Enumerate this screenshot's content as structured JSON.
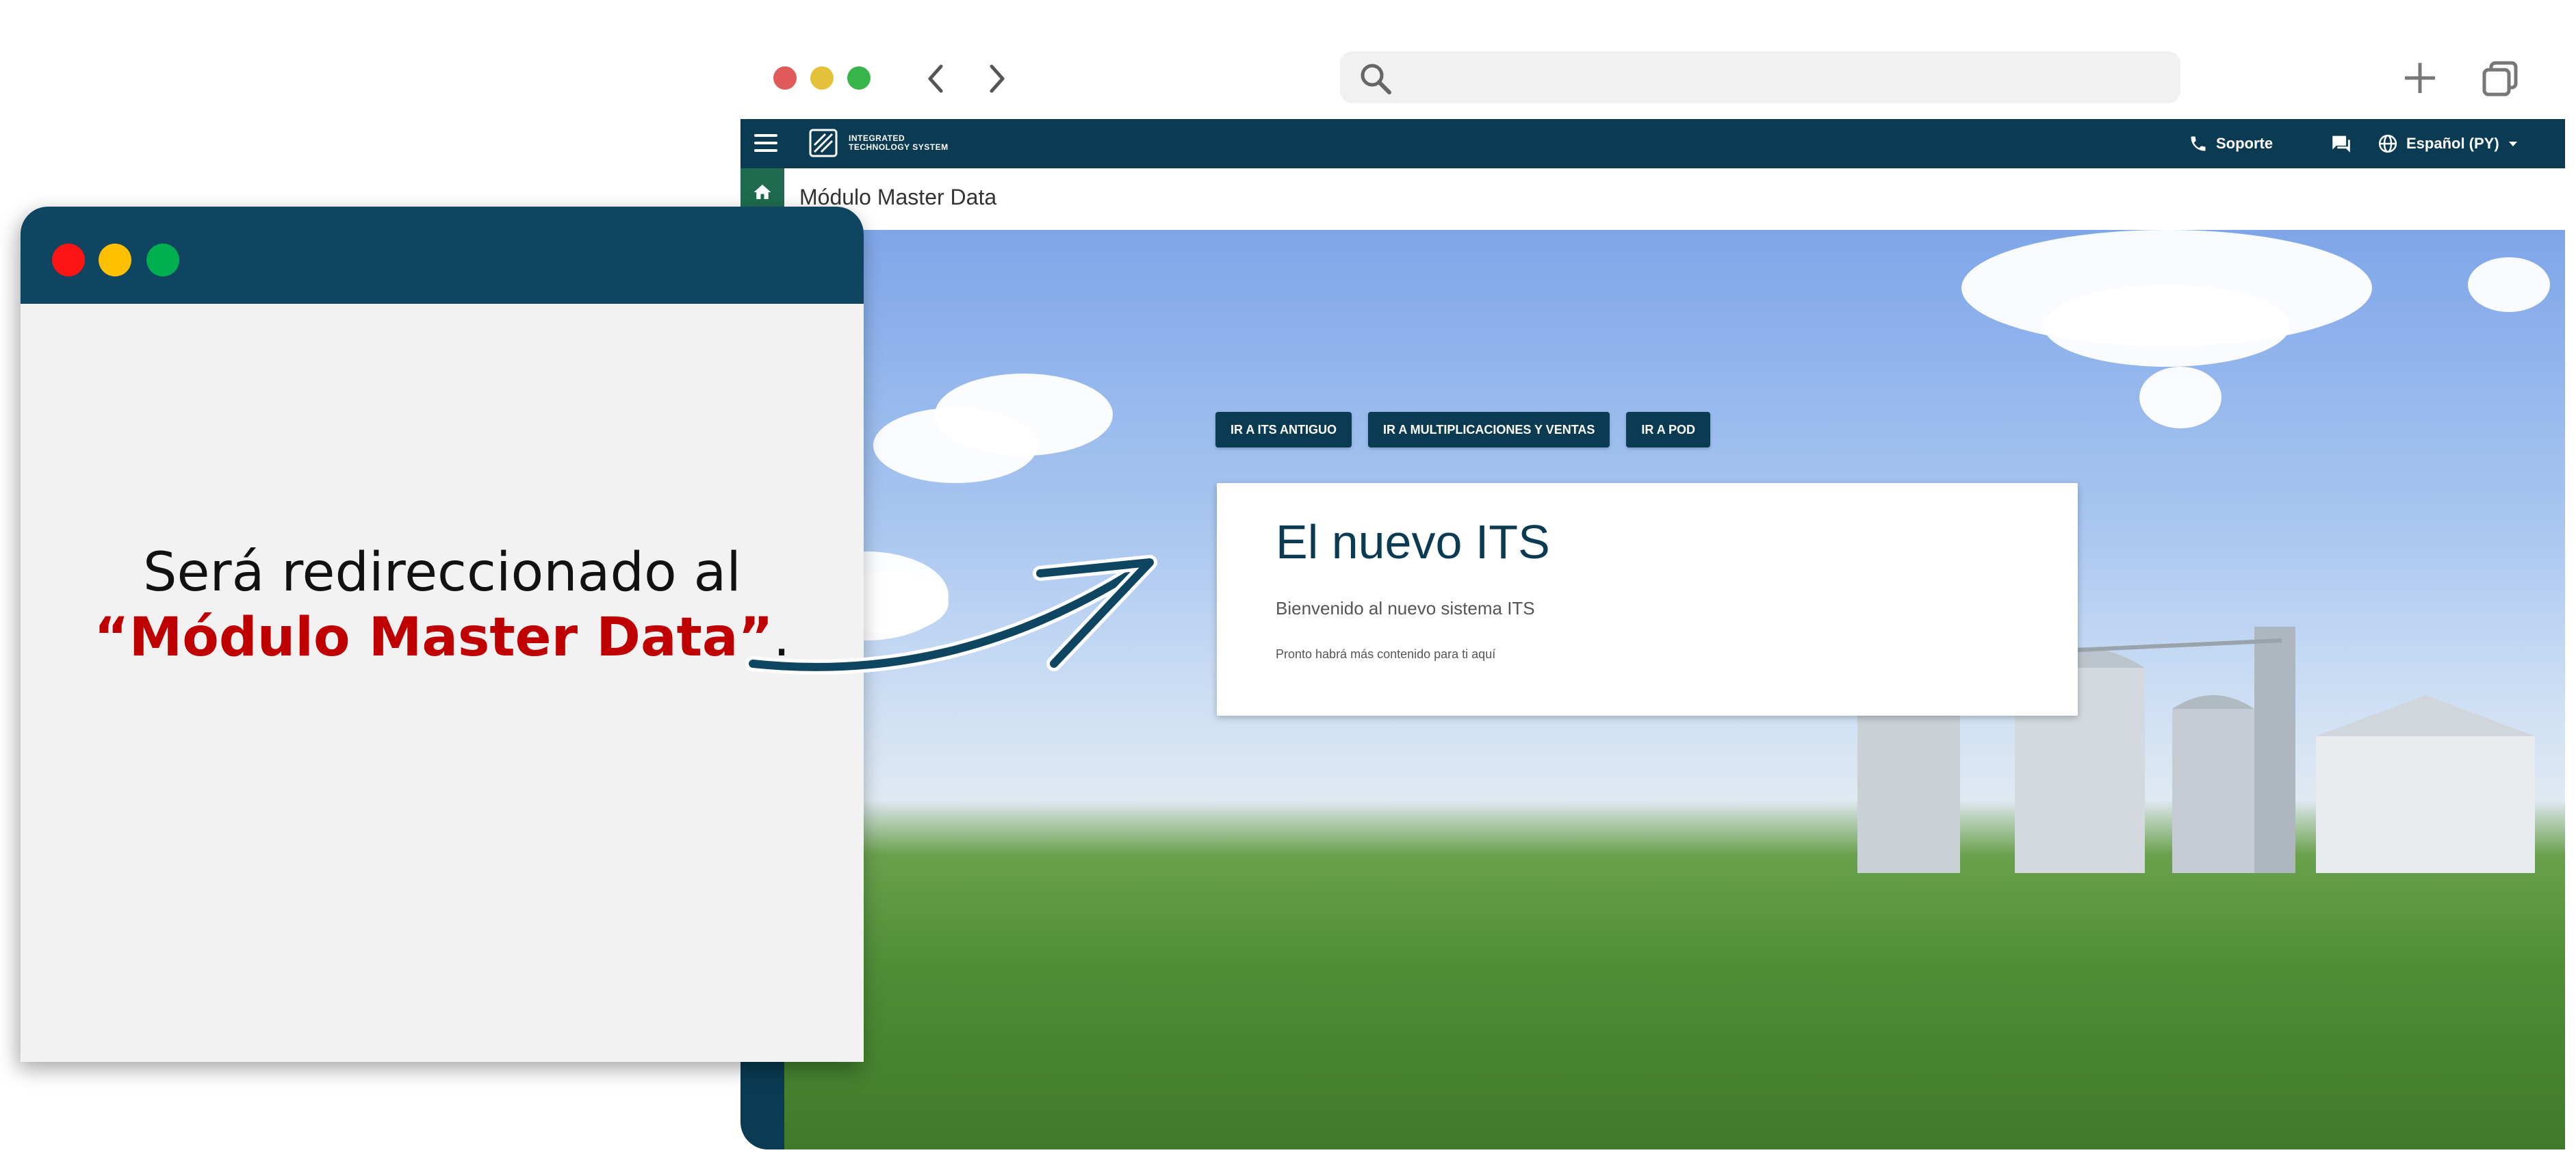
{
  "app_bar": {
    "logo_line1": "INTEGRATED",
    "logo_line2": "TECHNOLOGY SYSTEM",
    "support_label": "Soporte",
    "language_label": "Español (PY)"
  },
  "breadcrumb": {
    "title": "Módulo Master Data"
  },
  "hero": {
    "buttons": [
      "IR A ITS ANTIGUO",
      "IR A MULTIPLICACIONES Y VENTAS",
      "IR A POD"
    ],
    "card_title": "El nuevo ITS",
    "card_subtitle": "Bienvenido al nuevo sistema ITS",
    "card_note": "Pronto habrá más contenido para ti aquí"
  },
  "callout": {
    "line1": "Será redireccionado al",
    "line2": "“Módulo Master Data”",
    "line2_end": "."
  },
  "colors": {
    "primary": "#0b3b53",
    "home_tab": "#1f6b4f",
    "callout_highlight": "#c00000"
  }
}
